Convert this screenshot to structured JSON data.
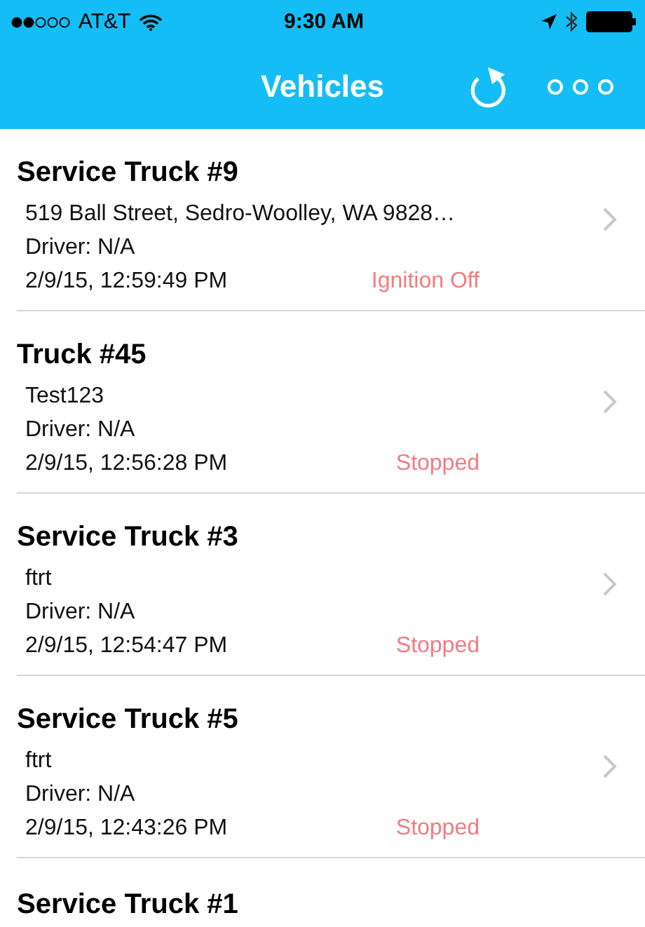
{
  "status_bar": {
    "carrier": "AT&T",
    "time": "9:30 AM"
  },
  "nav_bar": {
    "title": "Vehicles"
  },
  "vehicles": [
    {
      "name": "Service Truck #9",
      "line_1": "519 Ball Street, Sedro-Woolley, WA 9828…",
      "driver": "Driver: N/A",
      "timestamp": "2/9/15, 12:59:49 PM",
      "status": "Ignition Off"
    },
    {
      "name": "Truck #45",
      "line_1": "Test123",
      "driver": "Driver: N/A",
      "timestamp": "2/9/15, 12:56:28 PM",
      "status": "Stopped"
    },
    {
      "name": "Service Truck #3",
      "line_1": "ftrt",
      "driver": "Driver: N/A",
      "timestamp": "2/9/15, 12:54:47 PM",
      "status": "Stopped"
    },
    {
      "name": "Service Truck #5",
      "line_1": "ftrt",
      "driver": "Driver: N/A",
      "timestamp": "2/9/15, 12:43:26 PM",
      "status": "Stopped"
    },
    {
      "name": "Service Truck #1"
    }
  ]
}
